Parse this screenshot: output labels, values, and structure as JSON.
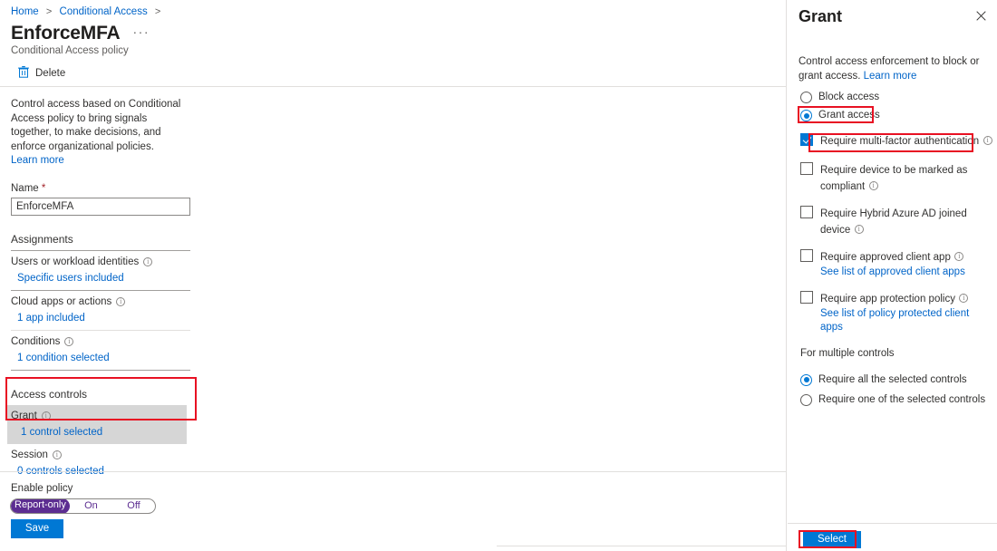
{
  "breadcrumb": {
    "items": [
      "Home",
      "Conditional Access"
    ],
    "separator": ">"
  },
  "page": {
    "title": "EnforceMFA",
    "ellipsis": "···",
    "subtitle": "Conditional Access policy"
  },
  "command_bar": {
    "delete_label": "Delete",
    "delete_icon": "trash-icon"
  },
  "intro": {
    "text": "Control access based on Conditional Access policy to bring signals together, to make decisions, and enforce organizational policies.",
    "learn_more": "Learn more"
  },
  "name_field": {
    "label": "Name",
    "required_mark": "*",
    "value": "EnforceMFA",
    "placeholder": "Name"
  },
  "assignments": {
    "heading": "Assignments",
    "rows": [
      {
        "label": "Users or workload identities",
        "value": "Specific users included",
        "info_icon": "info-icon"
      },
      {
        "label": "Cloud apps or actions",
        "value": "1 app included",
        "info_icon": "info-icon"
      },
      {
        "label": "Conditions",
        "value": "1 condition selected",
        "info_icon": "info-icon"
      }
    ]
  },
  "access_controls": {
    "heading": "Access controls",
    "grant": {
      "label": "Grant",
      "value": "1 control selected",
      "info_icon": "info-icon",
      "selected": true
    },
    "session": {
      "label": "Session",
      "value": "0 controls selected",
      "info_icon": "info-icon",
      "selected": false
    }
  },
  "enable_policy": {
    "label": "Enable policy",
    "options": [
      "Report-only",
      "On",
      "Off"
    ],
    "selected": "Report-only",
    "accent": "#5c2d91"
  },
  "save_button": {
    "label": "Save",
    "color": "#0078d4"
  },
  "grant_panel": {
    "title": "Grant",
    "close_icon": "close-icon",
    "description": "Control access enforcement to block or grant access.",
    "learn_more": "Learn more",
    "access_options": [
      {
        "label": "Block access",
        "selected": false
      },
      {
        "label": "Grant access",
        "selected": true
      }
    ],
    "controls": [
      {
        "label": "Require multi-factor authentication",
        "checked": true,
        "info_icon": "info-icon",
        "sublink": null
      },
      {
        "label": "Require device to be marked as compliant",
        "checked": false,
        "info_icon": "info-icon",
        "sublink": null
      },
      {
        "label": "Require Hybrid Azure AD joined device",
        "checked": false,
        "info_icon": "info-icon",
        "sublink": null
      },
      {
        "label": "Require approved client app",
        "checked": false,
        "info_icon": "info-icon",
        "sublink": "See list of approved client apps"
      },
      {
        "label": "Require app protection policy",
        "checked": false,
        "info_icon": "info-icon",
        "sublink": "See list of policy protected client apps"
      }
    ],
    "multiple_controls": {
      "title": "For multiple controls",
      "options": [
        {
          "label": "Require all the selected controls",
          "selected": true
        },
        {
          "label": "Require one of the selected controls",
          "selected": false
        }
      ]
    },
    "select_button": {
      "label": "Select",
      "color": "#0078d4"
    }
  },
  "annotations": {
    "color": "#e81123",
    "boxes": [
      "grant-access-radio",
      "require-mfa-checkbox",
      "grant-control-left",
      "select-button"
    ]
  }
}
